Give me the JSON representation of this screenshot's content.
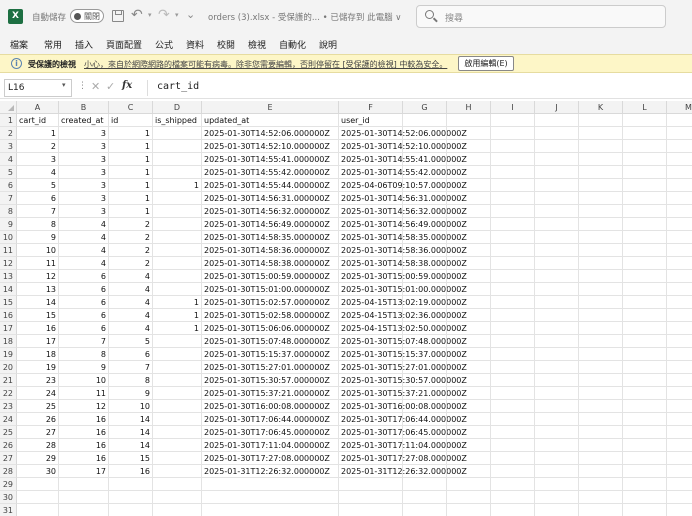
{
  "app": {
    "logo": "X"
  },
  "titlebar": {
    "autosave_label": "自動儲存",
    "autosave_state": "關閉",
    "doc_title": "orders (3).xlsx  -  受保護的...  •  已儲存到 此電腦 ∨",
    "search_placeholder": "搜尋"
  },
  "ribbon": {
    "tabs": [
      "檔案",
      "常用",
      "插入",
      "頁面配置",
      "公式",
      "資料",
      "校閱",
      "檢視",
      "自動化",
      "說明"
    ]
  },
  "protected_view": {
    "title": "受保護的檢視",
    "message": "小心，來自於網際網路的檔案可能有病毒。除非您需要編輯，否則停留在 [受保護的檢視] 中較為安全。",
    "button": "啟用編輯(E)"
  },
  "formula_bar": {
    "name_box": "L16",
    "formula": "cart_id"
  },
  "sheet": {
    "columns": [
      "A",
      "B",
      "C",
      "D",
      "E",
      "F",
      "G",
      "H",
      "I",
      "J",
      "K",
      "L",
      "M"
    ],
    "row_numbers": [
      "1",
      "2",
      "3",
      "4",
      "5",
      "6",
      "7",
      "8",
      "9",
      "10",
      "11",
      "12",
      "13",
      "14",
      "15",
      "16",
      "17",
      "18",
      "19",
      "20",
      "21",
      "22",
      "23",
      "24",
      "25",
      "26",
      "27",
      "28",
      "29",
      "30",
      "31"
    ],
    "header": [
      "cart_id",
      "created_at",
      "id",
      "is_shipped",
      "updated_at",
      "user_id"
    ],
    "rows": [
      [
        "1",
        "3",
        "1",
        "",
        "2025-01-30T14:52:06.000000Z",
        "2025-01-30T14:52:06.000000Z"
      ],
      [
        "2",
        "3",
        "1",
        "",
        "2025-01-30T14:52:10.000000Z",
        "2025-01-30T14:52:10.000000Z"
      ],
      [
        "3",
        "3",
        "1",
        "",
        "2025-01-30T14:55:41.000000Z",
        "2025-01-30T14:55:41.000000Z"
      ],
      [
        "4",
        "3",
        "1",
        "",
        "2025-01-30T14:55:42.000000Z",
        "2025-01-30T14:55:42.000000Z"
      ],
      [
        "5",
        "3",
        "1",
        "1",
        "2025-01-30T14:55:44.000000Z",
        "2025-04-06T09:10:57.000000Z"
      ],
      [
        "6",
        "3",
        "1",
        "",
        "2025-01-30T14:56:31.000000Z",
        "2025-01-30T14:56:31.000000Z"
      ],
      [
        "7",
        "3",
        "1",
        "",
        "2025-01-30T14:56:32.000000Z",
        "2025-01-30T14:56:32.000000Z"
      ],
      [
        "8",
        "4",
        "2",
        "",
        "2025-01-30T14:56:49.000000Z",
        "2025-01-30T14:56:49.000000Z"
      ],
      [
        "9",
        "4",
        "2",
        "",
        "2025-01-30T14:58:35.000000Z",
        "2025-01-30T14:58:35.000000Z"
      ],
      [
        "10",
        "4",
        "2",
        "",
        "2025-01-30T14:58:36.000000Z",
        "2025-01-30T14:58:36.000000Z"
      ],
      [
        "11",
        "4",
        "2",
        "",
        "2025-01-30T14:58:38.000000Z",
        "2025-01-30T14:58:38.000000Z"
      ],
      [
        "12",
        "6",
        "4",
        "",
        "2025-01-30T15:00:59.000000Z",
        "2025-01-30T15:00:59.000000Z"
      ],
      [
        "13",
        "6",
        "4",
        "",
        "2025-01-30T15:01:00.000000Z",
        "2025-01-30T15:01:00.000000Z"
      ],
      [
        "14",
        "6",
        "4",
        "1",
        "2025-01-30T15:02:57.000000Z",
        "2025-04-15T13:02:19.000000Z"
      ],
      [
        "15",
        "6",
        "4",
        "1",
        "2025-01-30T15:02:58.000000Z",
        "2025-04-15T13:02:36.000000Z"
      ],
      [
        "16",
        "6",
        "4",
        "1",
        "2025-01-30T15:06:06.000000Z",
        "2025-04-15T13:02:50.000000Z"
      ],
      [
        "17",
        "7",
        "5",
        "",
        "2025-01-30T15:07:48.000000Z",
        "2025-01-30T15:07:48.000000Z"
      ],
      [
        "18",
        "8",
        "6",
        "",
        "2025-01-30T15:15:37.000000Z",
        "2025-01-30T15:15:37.000000Z"
      ],
      [
        "19",
        "9",
        "7",
        "",
        "2025-01-30T15:27:01.000000Z",
        "2025-01-30T15:27:01.000000Z"
      ],
      [
        "23",
        "10",
        "8",
        "",
        "2025-01-30T15:30:57.000000Z",
        "2025-01-30T15:30:57.000000Z"
      ],
      [
        "24",
        "11",
        "9",
        "",
        "2025-01-30T15:37:21.000000Z",
        "2025-01-30T15:37:21.000000Z"
      ],
      [
        "25",
        "12",
        "10",
        "",
        "2025-01-30T16:00:08.000000Z",
        "2025-01-30T16:00:08.000000Z"
      ],
      [
        "26",
        "16",
        "14",
        "",
        "2025-01-30T17:06:44.000000Z",
        "2025-01-30T17:06:44.000000Z"
      ],
      [
        "27",
        "16",
        "14",
        "",
        "2025-01-30T17:06:45.000000Z",
        "2025-01-30T17:06:45.000000Z"
      ],
      [
        "28",
        "16",
        "14",
        "",
        "2025-01-30T17:11:04.000000Z",
        "2025-01-30T17:11:04.000000Z"
      ],
      [
        "29",
        "16",
        "15",
        "",
        "2025-01-30T17:27:08.000000Z",
        "2025-01-30T17:27:08.000000Z"
      ],
      [
        "30",
        "17",
        "16",
        "",
        "2025-01-31T12:26:32.000000Z",
        "2025-01-31T12:26:32.000000Z"
      ]
    ]
  }
}
